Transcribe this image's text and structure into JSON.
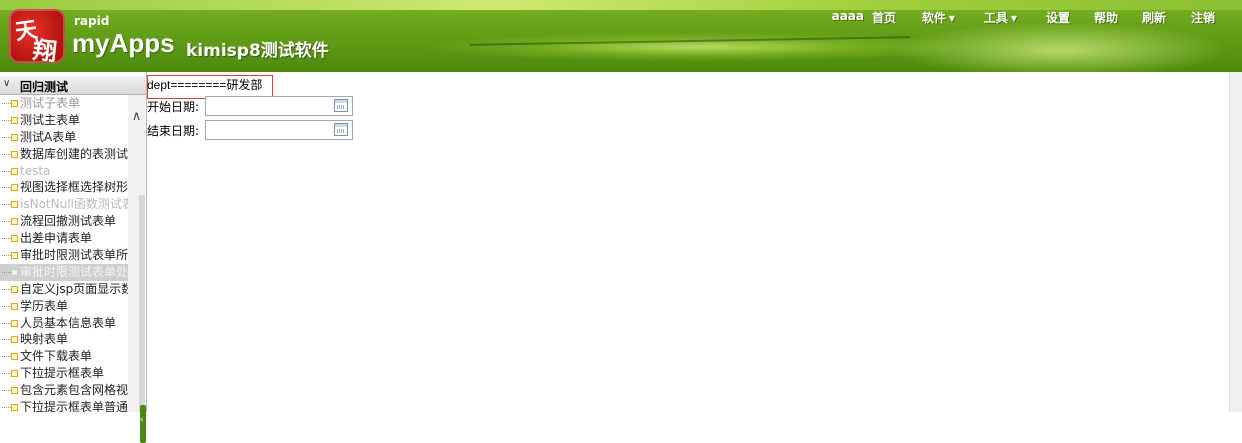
{
  "header": {
    "logo_glyphs": [
      "天",
      "翔"
    ],
    "brand_small": "rapid",
    "brand_big": "myApps",
    "app_title": "kimisp8测试软件",
    "nav": [
      {
        "label": "aaaa",
        "has_caret": false
      },
      {
        "label": "首页",
        "has_caret": false
      },
      {
        "label": "软件",
        "has_caret": true
      },
      {
        "label": "工具",
        "has_caret": true
      },
      {
        "label": "设置",
        "has_caret": false
      },
      {
        "label": "帮助",
        "has_caret": false
      },
      {
        "label": "刷新",
        "has_caret": false
      },
      {
        "label": "注销",
        "has_caret": false
      }
    ],
    "colors": {
      "header_green": "#5a9612",
      "logo_red": "#c4161c"
    }
  },
  "sidebar": {
    "title": "回归测试",
    "items": [
      "测试子表单",
      "测试主表单",
      "测试A表单",
      "数据库创建的表测试",
      "testa",
      "视图选择框选择树形视",
      "isNotNull函数测试表单",
      "流程回撤测试表单",
      "出差申请表单",
      "审批时限测试表单所有",
      "审批时限测试表单处理",
      "自定义jsp页面显示数",
      "学历表单",
      "人员基本信息表单",
      "映射表单",
      "文件下载表单",
      "下拉提示框表单",
      "包含元素包含网格视图",
      "下拉提示框表单普通列"
    ],
    "selected_index": 10
  },
  "main": {
    "dept_text": "dept========研发部",
    "fields": [
      {
        "label": "开始日期:",
        "value": ""
      },
      {
        "label": "结束日期:",
        "value": ""
      }
    ],
    "highlight_color": "#e53a3a"
  }
}
